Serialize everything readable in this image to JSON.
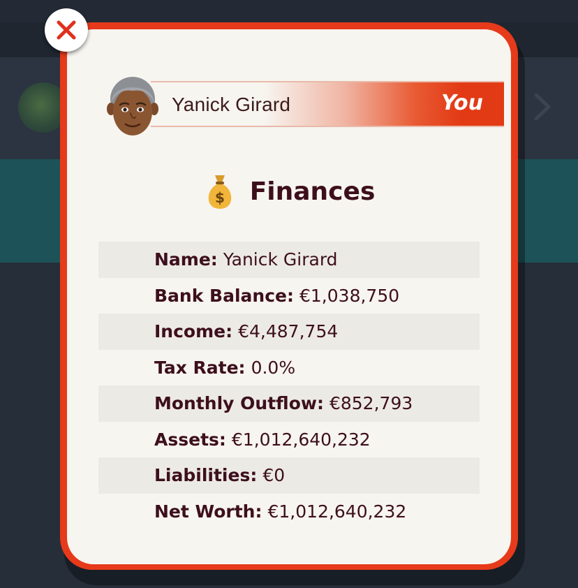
{
  "player": {
    "name": "Yanick Girard",
    "you_label": "You"
  },
  "finances": {
    "title": "Finances",
    "icon": "money-bag-icon",
    "rows": [
      {
        "label": "Name:",
        "value": "Yanick Girard"
      },
      {
        "label": "Bank Balance:",
        "value": "€1,038,750"
      },
      {
        "label": "Income:",
        "value": "€4,487,754"
      },
      {
        "label": "Tax Rate:",
        "value": "0.0%"
      },
      {
        "label": "Monthly Outflow:",
        "value": "€852,793"
      },
      {
        "label": "Assets:",
        "value": "€1,012,640,232"
      },
      {
        "label": "Liabilities:",
        "value": "€0"
      },
      {
        "label": "Net Worth:",
        "value": "€1,012,640,232"
      }
    ]
  },
  "colors": {
    "accent": "#e63a1a",
    "panel": "#f7f5f0",
    "text": "#3d0f1c",
    "row_alt": "#eceae5"
  }
}
